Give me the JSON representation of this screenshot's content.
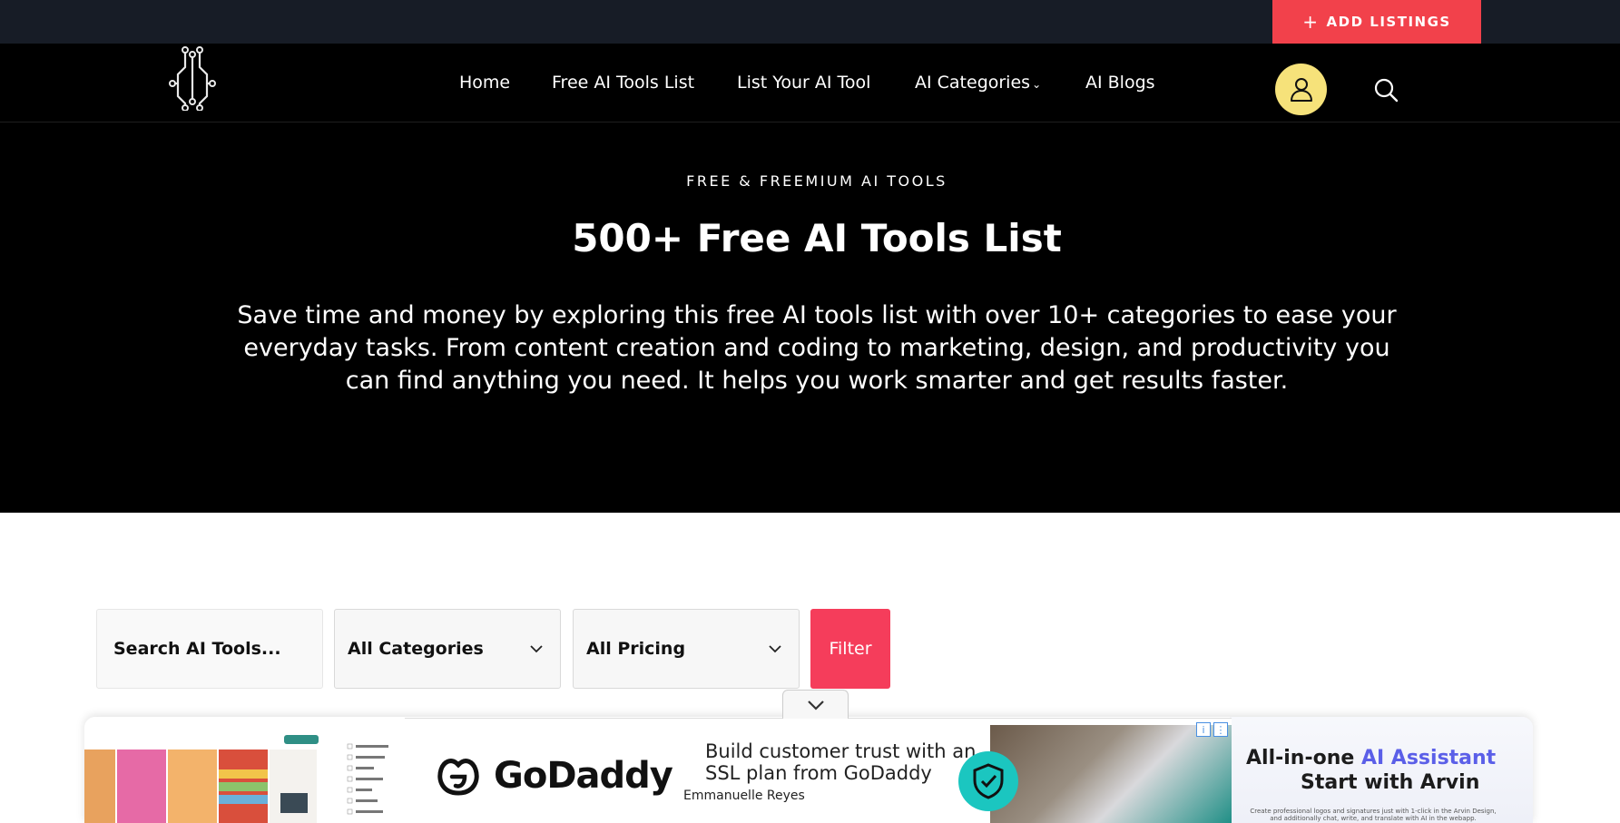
{
  "topbar": {
    "add_listings_label": "ADD LISTINGS"
  },
  "nav": {
    "items": [
      {
        "label": "Home"
      },
      {
        "label": "Free AI Tools List"
      },
      {
        "label": "List Your AI Tool"
      },
      {
        "label": "AI Categories"
      },
      {
        "label": "AI Blogs"
      }
    ]
  },
  "hero": {
    "eyebrow": "FREE & FREEMIUM AI TOOLS",
    "title": "500+ Free AI Tools List",
    "description": "Save time and money by exploring this free AI tools list with over 10+ categories to ease your everyday tasks. From content creation and coding to marketing, design, and productivity you can find anything you need. It helps you work smarter and get results faster."
  },
  "filters": {
    "search_text": "Search AI Tools...",
    "category_selected": "All Categories",
    "pricing_selected": "All Pricing",
    "filter_label": "Filter"
  },
  "ad": {
    "brand": "GoDaddy",
    "headline_1": "Build customer trust with an",
    "headline_2": "SSL plan from GoDaddy",
    "person": "Emmanuelle Reyes"
  },
  "cards": {
    "arvin_title_plain": "All-in-one ",
    "arvin_title_highlight": "AI Assistant",
    "arvin_subtitle": "Start with Arvin",
    "arvin_note": "Create professional logos and signatures just with 1-click in the Arvin Design, and additionally chat, write, and translate with AI in the webapp."
  },
  "colors": {
    "topbar": "#171c26",
    "accent_red": "#f2414b",
    "filter_pink": "#f53d5b",
    "user_yellow": "#f6e27a",
    "hero_bg": "#000000"
  }
}
